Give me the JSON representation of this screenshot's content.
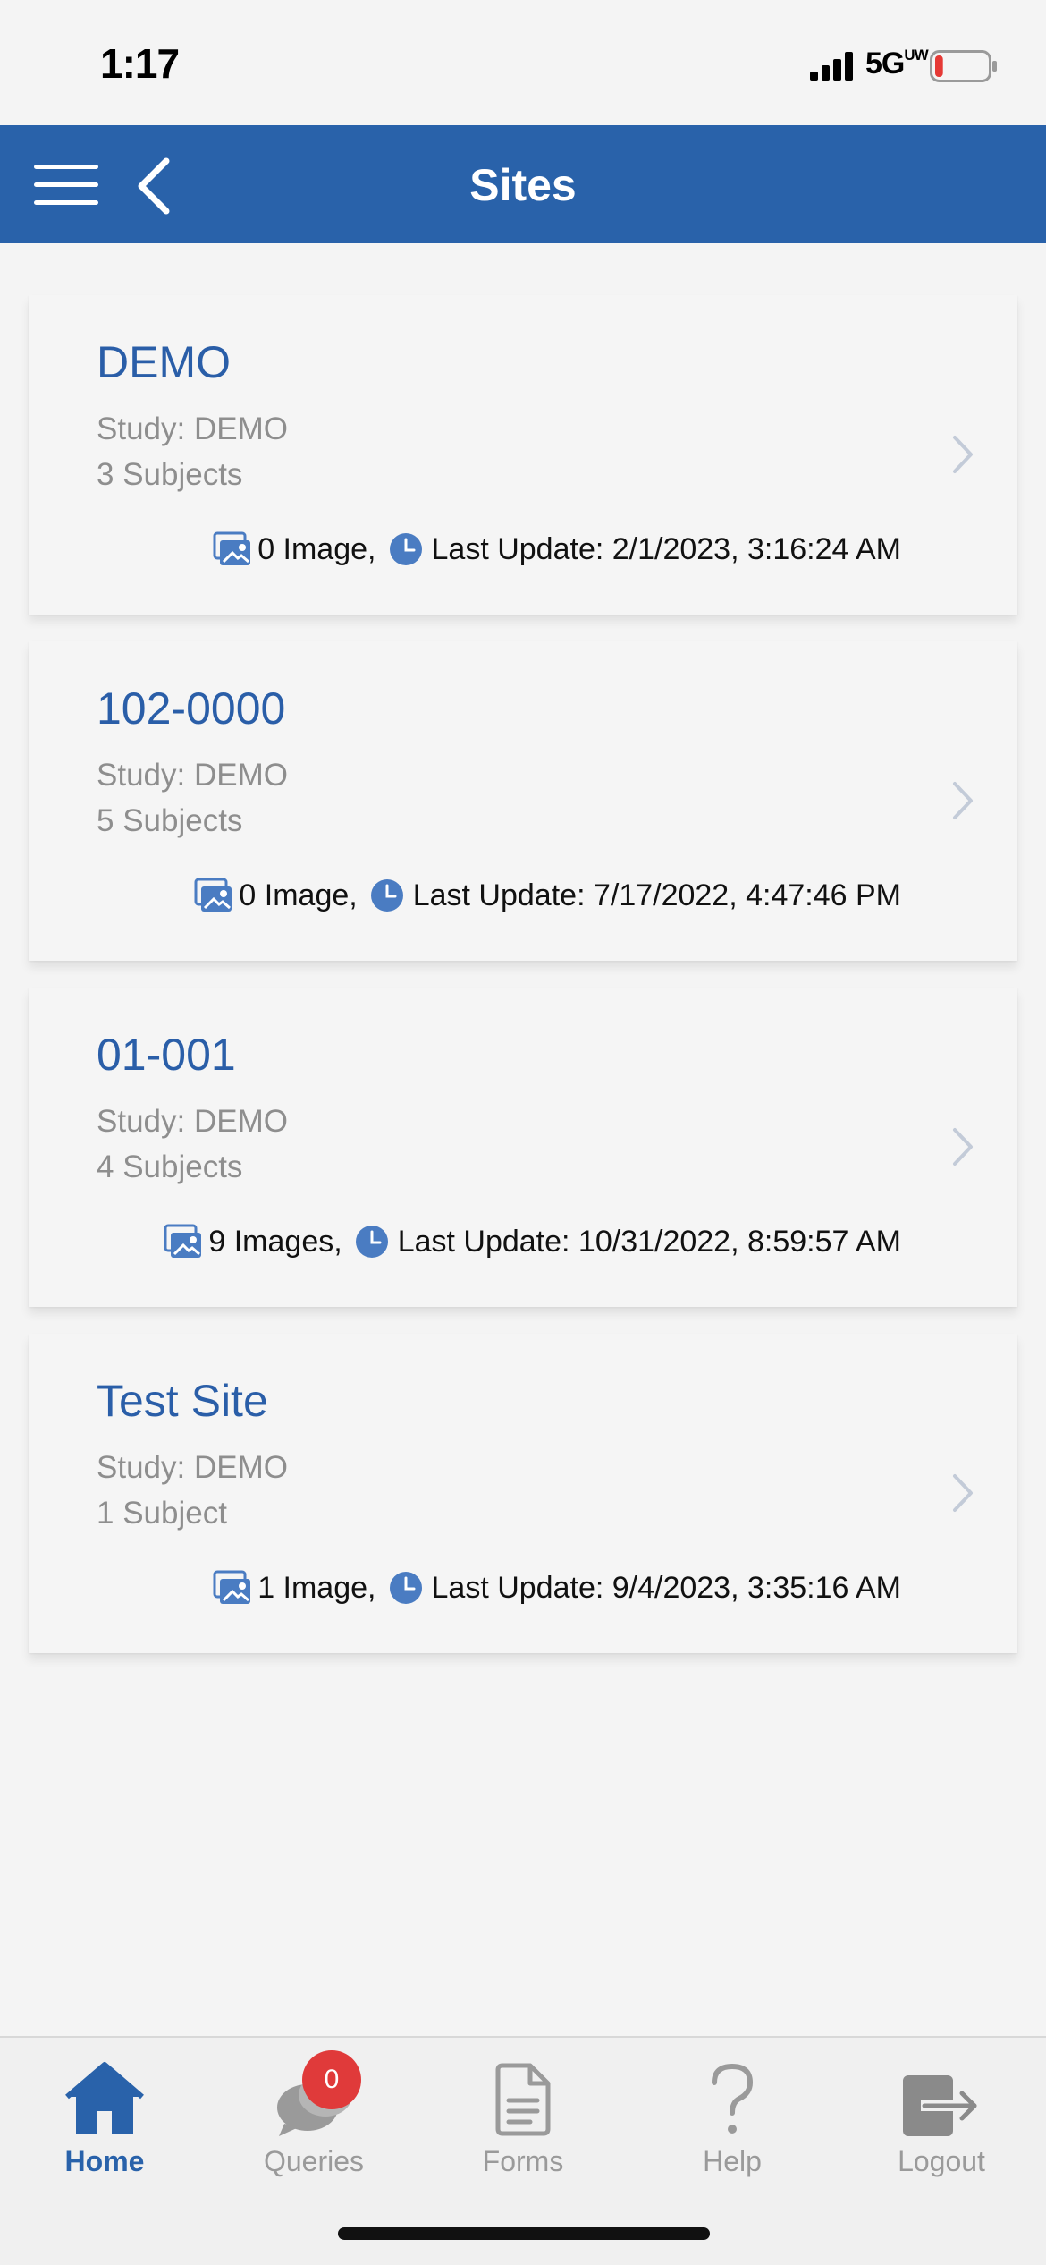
{
  "status_bar": {
    "time": "1:17",
    "network": "5G",
    "network_suffix": "UW",
    "battery_level_fraction": 0.15,
    "battery_color": "#e53935"
  },
  "header": {
    "title": "Sites",
    "background_color": "#2962aa",
    "menu_icon": "hamburger-menu-icon",
    "back_icon": "back-chevron-icon"
  },
  "sites": [
    {
      "name": "DEMO",
      "study": "Study: DEMO",
      "subjects": "3 Subjects",
      "images": "0 Image,",
      "last_update": "Last Update: 2/1/2023, 3:16:24 AM"
    },
    {
      "name": "102-0000",
      "study": "Study: DEMO",
      "subjects": "5 Subjects",
      "images": "0 Image,",
      "last_update": "Last Update: 7/17/2022, 4:47:46 PM"
    },
    {
      "name": "01-001",
      "study": "Study: DEMO",
      "subjects": "4 Subjects",
      "images": "9 Images,",
      "last_update": "Last Update: 10/31/2022, 8:59:57 AM"
    },
    {
      "name": "Test Site",
      "study": "Study: DEMO",
      "subjects": "1 Subject",
      "images": "1 Image,",
      "last_update": "Last Update: 9/4/2023, 3:35:16 AM"
    }
  ],
  "tab_bar": {
    "active_color": "#2962aa",
    "inactive_color": "#9a9a9a",
    "tabs": [
      {
        "label": "Home",
        "icon": "home-icon",
        "active": true
      },
      {
        "label": "Queries",
        "icon": "chat-bubbles-icon",
        "badge": "0",
        "badge_color": "#e03a3a"
      },
      {
        "label": "Forms",
        "icon": "document-icon"
      },
      {
        "label": "Help",
        "icon": "question-mark-icon"
      },
      {
        "label": "Logout",
        "icon": "logout-icon"
      }
    ]
  }
}
